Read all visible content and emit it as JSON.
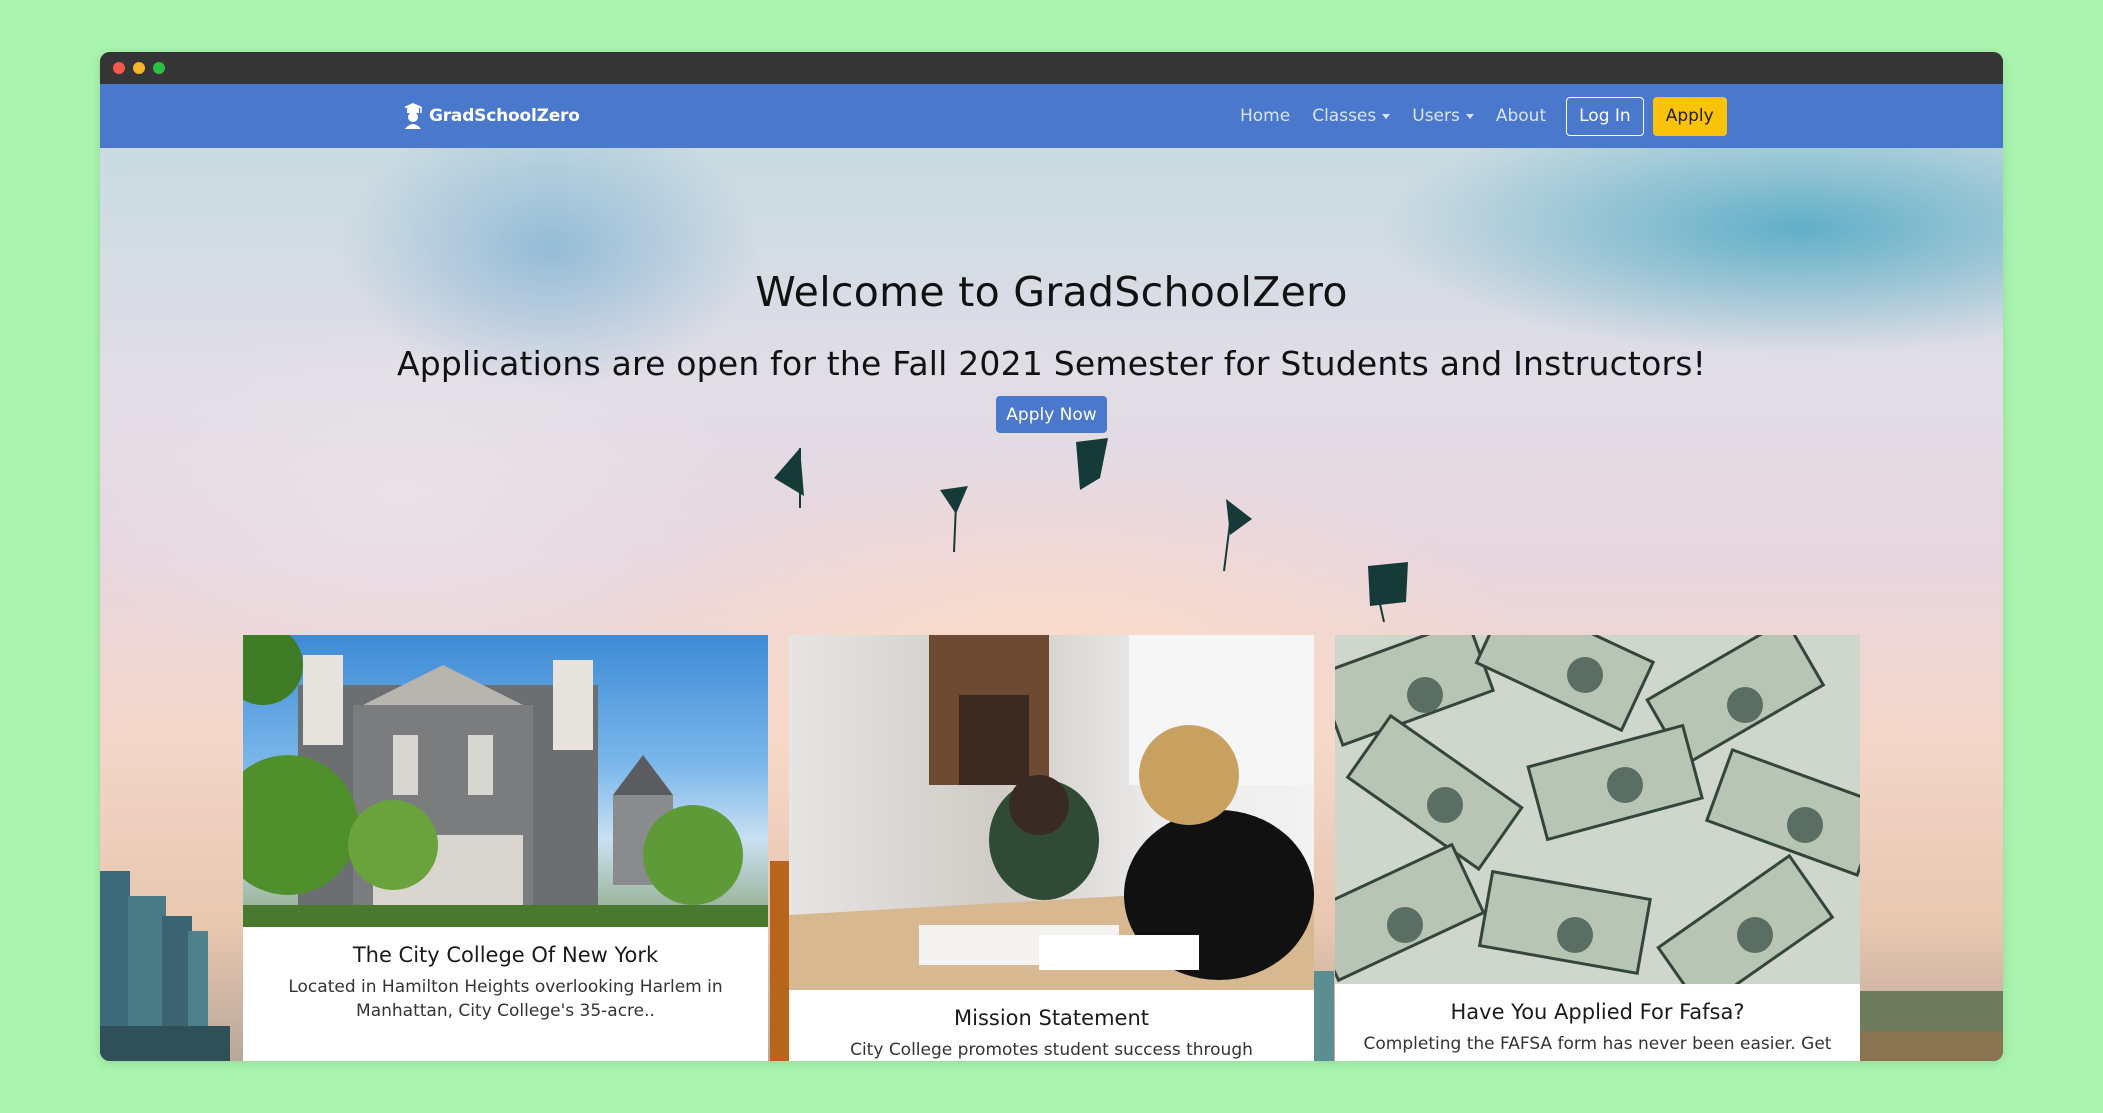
{
  "brand": {
    "name": "GradSchoolZero",
    "logo_icon": "graduate-logo-icon"
  },
  "nav": {
    "home": "Home",
    "classes": "Classes",
    "users": "Users",
    "about": "About",
    "login": "Log In",
    "apply": "Apply"
  },
  "hero": {
    "title": "Welcome to GradSchoolZero",
    "subtitle": "Applications are open for the Fall 2021 Semester for Students and Instructors!",
    "cta": "Apply Now"
  },
  "cards": [
    {
      "title": "The City College Of New York",
      "text": "Located in Hamilton Heights overlooking Harlem in Manhattan, City College's 35-acre..",
      "image": "campus-building-photo"
    },
    {
      "title": "Mission Statement",
      "text": "City College promotes student success through exceptional",
      "image": "students-studying-photo"
    },
    {
      "title": "Have You Applied For Fafsa?",
      "text": "Completing the FAFSA form has never been easier. Get an",
      "image": "dollar-bills-photo"
    }
  ],
  "colors": {
    "page_bg": "#a9f4ae",
    "navbar": "#4a78cd",
    "apply_button": "#fbc20a"
  }
}
